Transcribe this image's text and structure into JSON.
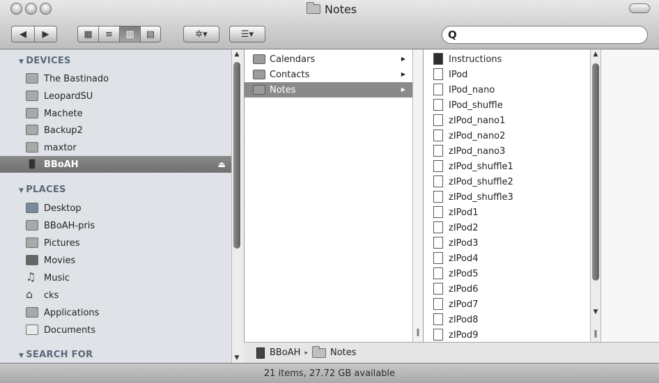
{
  "window": {
    "title": "Notes"
  },
  "toolbar": {
    "back": "◀",
    "forward": "▶",
    "view_icon": "▦",
    "view_list": "≡",
    "view_column": "▥",
    "view_coverflow": "▤",
    "action": "✲▾",
    "arrange": "☰▾",
    "search_value": "",
    "search_icon_glyph": "Q"
  },
  "sidebar": {
    "devices_header": "DEVICES",
    "devices": [
      {
        "label": "The Bastinado",
        "icon": "hard-drive-icon"
      },
      {
        "label": "LeopardSU",
        "icon": "hard-drive-icon"
      },
      {
        "label": "Machete",
        "icon": "hard-drive-icon"
      },
      {
        "label": "Backup2",
        "icon": "hard-drive-icon"
      },
      {
        "label": "maxtor",
        "icon": "hard-drive-icon"
      },
      {
        "label": "BBoAH",
        "icon": "ipod-icon",
        "selected": true,
        "eject": "⏏"
      }
    ],
    "places_header": "PLACES",
    "places": [
      {
        "label": "Desktop",
        "icon": "desktop-icon"
      },
      {
        "label": "BBoAH-pris",
        "icon": "folder-icon"
      },
      {
        "label": "Pictures",
        "icon": "pictures-icon"
      },
      {
        "label": "Movies",
        "icon": "movies-icon"
      },
      {
        "label": "Music",
        "icon": "music-icon"
      },
      {
        "label": "cks",
        "icon": "home-icon"
      },
      {
        "label": "Applications",
        "icon": "applications-icon"
      },
      {
        "label": "Documents",
        "icon": "documents-icon"
      }
    ],
    "search_header": "SEARCH FOR"
  },
  "column1": [
    {
      "label": "Calendars"
    },
    {
      "label": "Contacts"
    },
    {
      "label": "Notes",
      "selected": true
    }
  ],
  "column2": [
    {
      "label": "Instructions",
      "dark": true
    },
    {
      "label": "IPod"
    },
    {
      "label": "IPod_nano"
    },
    {
      "label": "IPod_shuffle"
    },
    {
      "label": "zIPod_nano1"
    },
    {
      "label": "zIPod_nano2"
    },
    {
      "label": "zIPod_nano3"
    },
    {
      "label": "zIPod_shuffle1"
    },
    {
      "label": "zIPod_shuffle2"
    },
    {
      "label": "zIPod_shuffle3"
    },
    {
      "label": "zIPod1"
    },
    {
      "label": "zIPod2"
    },
    {
      "label": "zIPod3"
    },
    {
      "label": "zIPod4"
    },
    {
      "label": "zIPod5"
    },
    {
      "label": "zIPod6"
    },
    {
      "label": "zIPod7"
    },
    {
      "label": "zIPod8"
    },
    {
      "label": "zIPod9"
    }
  ],
  "pathbar": {
    "volume": "BBoAH",
    "folder": "Notes",
    "separator": "▸"
  },
  "status": {
    "text": "21 items, 27.72 GB available"
  }
}
